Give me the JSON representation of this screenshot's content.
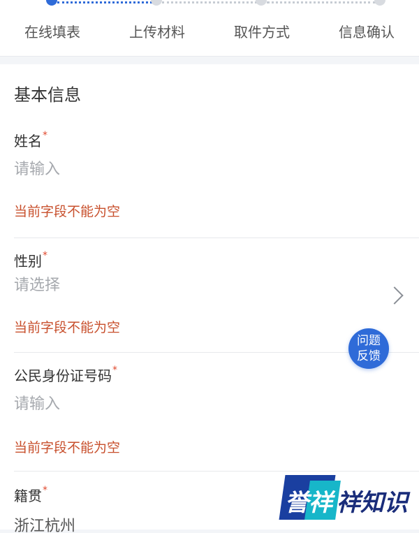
{
  "stepper": {
    "steps": [
      {
        "label": "在线填表",
        "active": true
      },
      {
        "label": "上传材料",
        "active": false
      },
      {
        "label": "取件方式",
        "active": false
      },
      {
        "label": "信息确认",
        "active": false
      }
    ]
  },
  "form": {
    "section_title": "基本信息",
    "required_mark": "*",
    "fields": [
      {
        "label": "姓名",
        "placeholder": "请输入",
        "type": "text",
        "error": "当前字段不能为空"
      },
      {
        "label": "性别",
        "placeholder": "请选择",
        "type": "select",
        "error": "当前字段不能为空"
      },
      {
        "label": "公民身份证号码",
        "placeholder": "请输入",
        "type": "text",
        "error": "当前字段不能为空"
      },
      {
        "label": "籍贯",
        "value": "浙江杭州",
        "type": "text"
      }
    ]
  },
  "feedback": {
    "line1": "问题",
    "line2": "反馈"
  },
  "watermark": {
    "text_a": "誉祥",
    "text_b": "祥知识"
  },
  "colors": {
    "accent": "#2f6bd8",
    "error": "#c8502d",
    "required": "#e04a2f"
  },
  "icons": {
    "select_arrow": "chevron-right-icon"
  }
}
